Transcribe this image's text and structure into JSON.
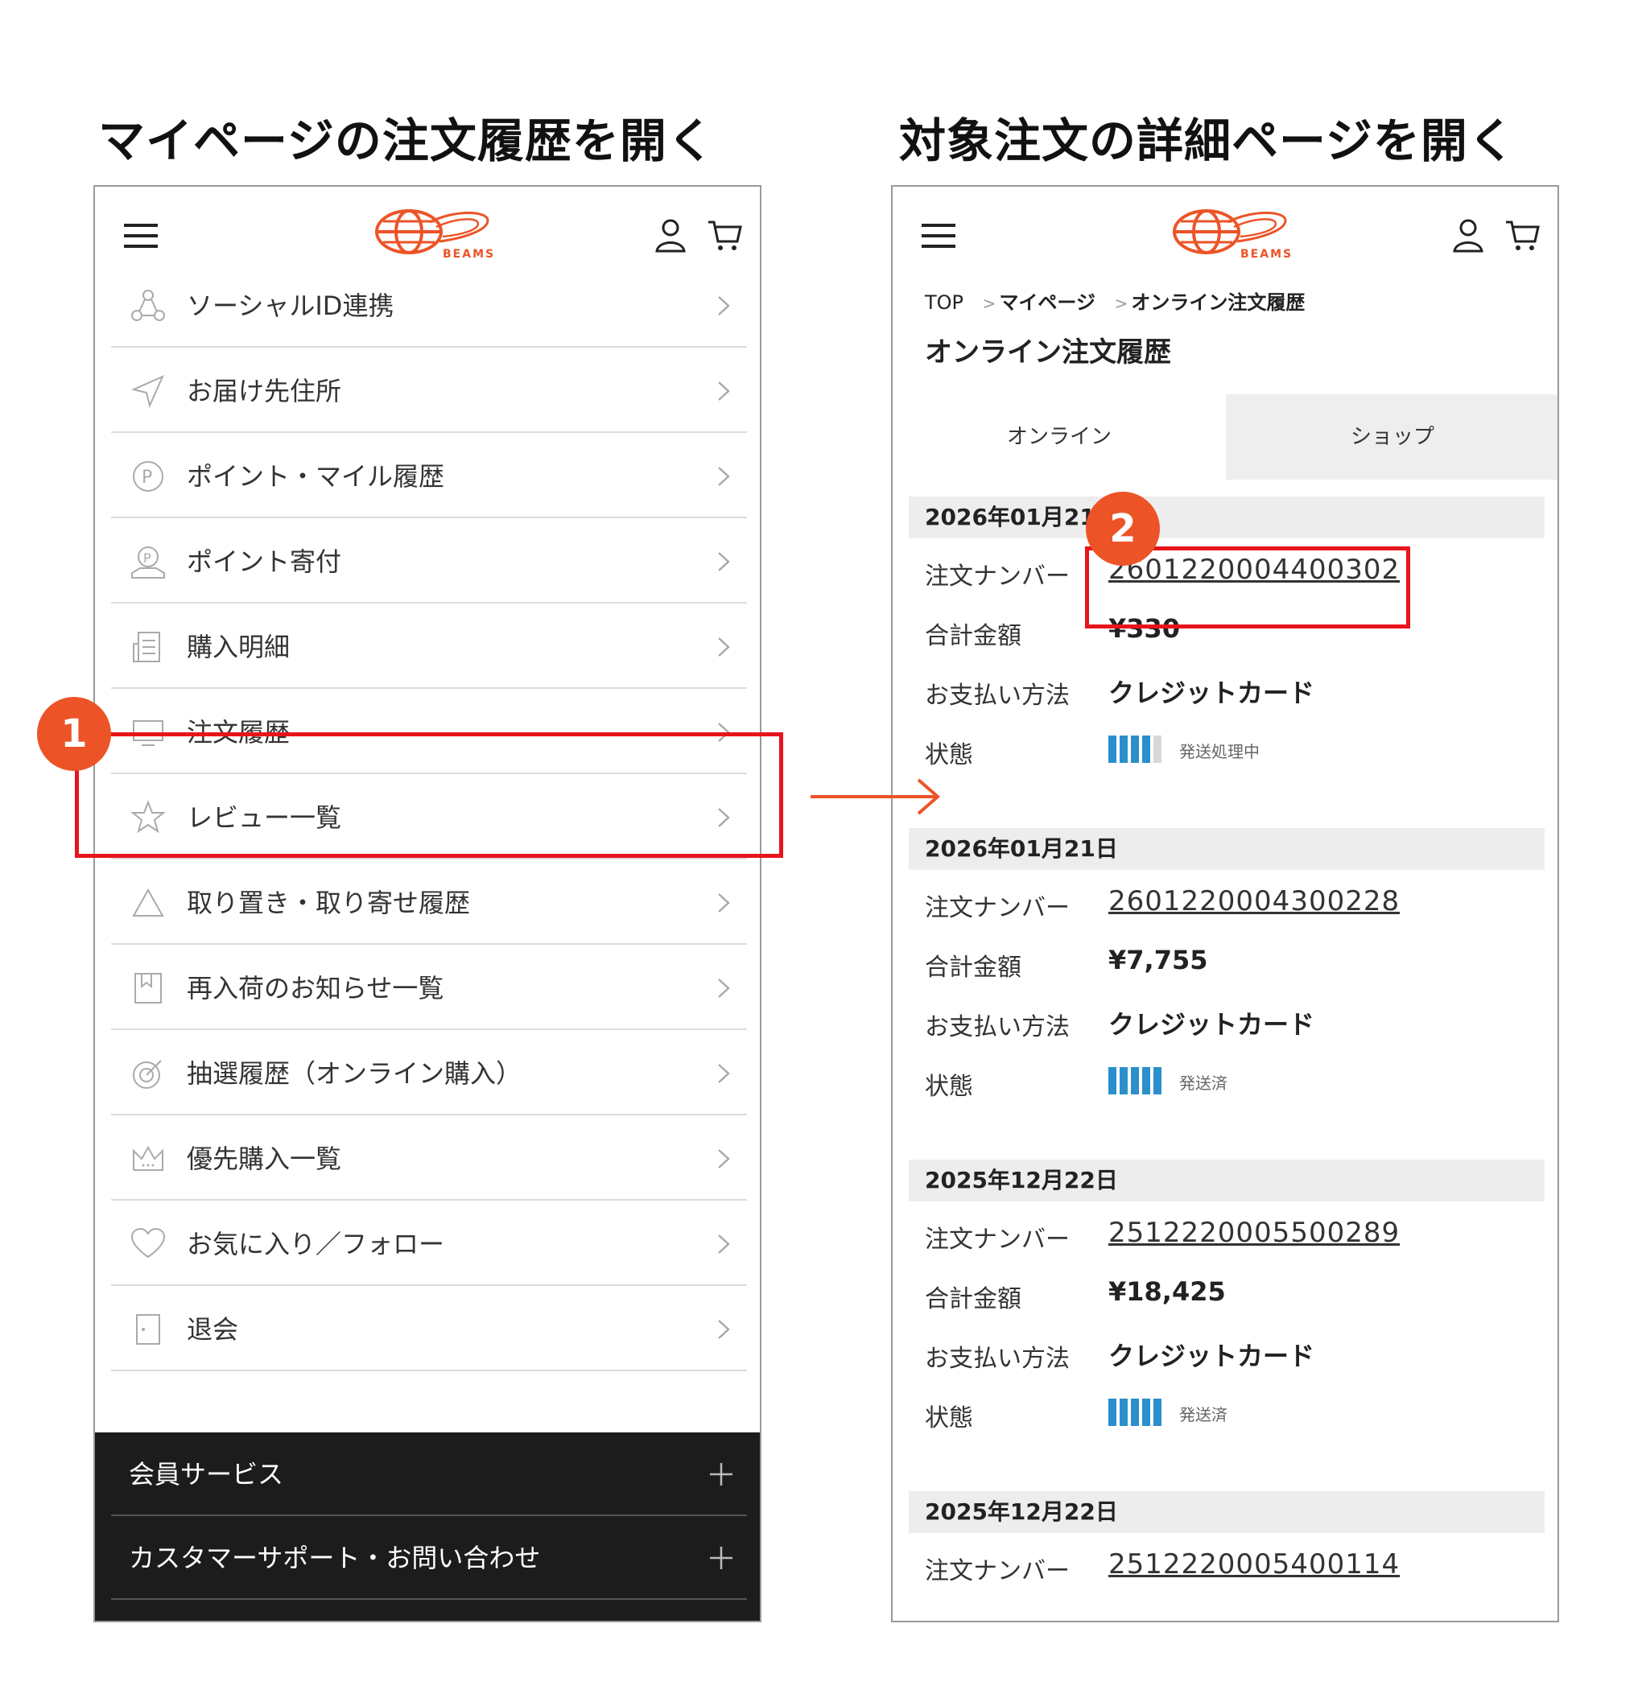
{
  "headings": {
    "left": "マイページの注文履歴を開く",
    "right": "対象注文の詳細ページを開く"
  },
  "brand": {
    "logo_text": "BEAMS",
    "color": "#ec5427"
  },
  "left_menu": {
    "items": [
      {
        "label": "ソーシャルID連携",
        "icon": "social-share-icon"
      },
      {
        "label": "お届け先住所",
        "icon": "send-arrow-icon"
      },
      {
        "label": "ポイント・マイル履歴",
        "icon": "point-circle-icon"
      },
      {
        "label": "ポイント寄付",
        "icon": "point-donate-icon"
      },
      {
        "label": "購入明細",
        "icon": "receipt-icon"
      },
      {
        "label": "注文履歴",
        "icon": "monitor-icon"
      },
      {
        "label": "レビュー一覧",
        "icon": "star-icon"
      },
      {
        "label": "取り置き・取り寄せ履歴",
        "icon": "hanger-icon"
      },
      {
        "label": "再入荷のお知らせ一覧",
        "icon": "bookmark-icon"
      },
      {
        "label": "抽選履歴（オンライン購入）",
        "icon": "target-icon"
      },
      {
        "label": "優先購入一覧",
        "icon": "crown-icon"
      },
      {
        "label": "お気に入り／フォロー",
        "icon": "heart-icon"
      },
      {
        "label": "退会",
        "icon": "door-icon"
      }
    ],
    "footer": [
      {
        "label": "会員サービス"
      },
      {
        "label": "カスタマーサポート・お問い合わせ"
      }
    ]
  },
  "order_page": {
    "breadcrumb": [
      "TOP",
      "マイページ",
      "オンライン注文履歴"
    ],
    "title": "オンライン注文履歴",
    "tabs": [
      {
        "label": "オンライン",
        "active": true
      },
      {
        "label": "ショップ",
        "active": false
      }
    ],
    "labels": {
      "number": "注文ナンバー",
      "total": "合計金額",
      "payment": "お支払い方法",
      "status": "状態"
    },
    "orders": [
      {
        "date": "2026年01月21日",
        "number": "2601220004400302",
        "total": "¥330",
        "payment": "クレジットカード",
        "status": "発送処理中",
        "progress_steps": 4
      },
      {
        "date": "2026年01月21日",
        "number": "2601220004300228",
        "total": "¥7,755",
        "payment": "クレジットカード",
        "status": "発送済",
        "progress_steps": 5
      },
      {
        "date": "2025年12月22日",
        "number": "2512220005500289",
        "total": "¥18,425",
        "payment": "クレジットカード",
        "status": "発送済",
        "progress_steps": 5
      },
      {
        "date": "2025年12月22日",
        "number": "2512220005400114"
      }
    ]
  },
  "annotations": {
    "step1": "1",
    "step2": "2",
    "highlight_color": "#e8141c",
    "progress_color": "#2b8fcb"
  }
}
